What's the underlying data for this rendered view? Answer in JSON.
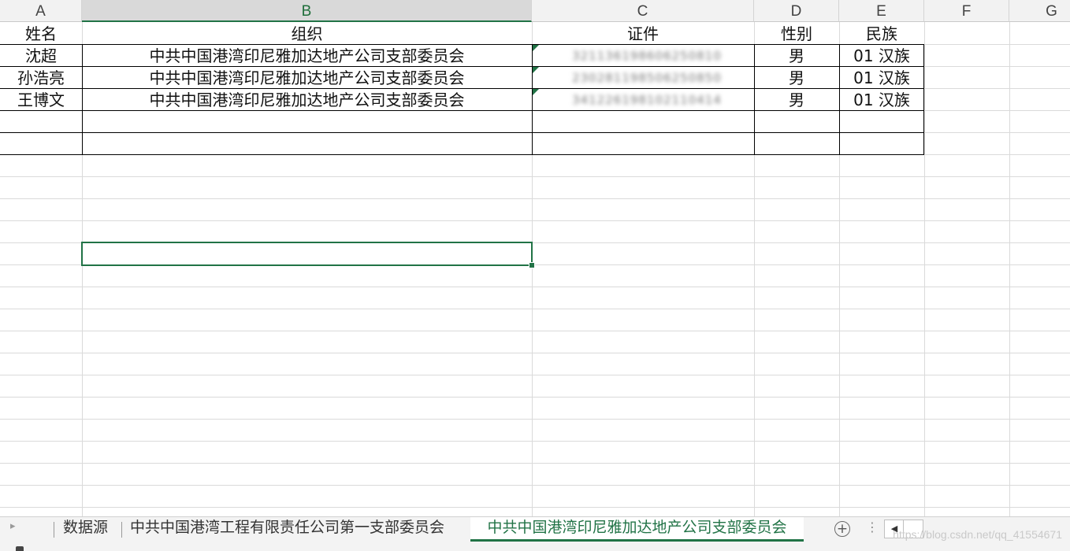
{
  "columns": [
    "A",
    "B",
    "C",
    "D",
    "E",
    "F",
    "G"
  ],
  "header_row": {
    "name": "姓名",
    "org": "组织",
    "id": "证件",
    "gender": "性别",
    "ethnicity": "民族"
  },
  "rows": [
    {
      "name": "沈超",
      "org": "中共中国港湾印尼雅加达地产公司支部委员会",
      "id": "321136198606250810",
      "gender": "男",
      "ethnicity": "01 汉族"
    },
    {
      "name": "孙浩亮",
      "org": "中共中国港湾印尼雅加达地产公司支部委员会",
      "id": "230281198506250850",
      "gender": "男",
      "ethnicity": "01 汉族"
    },
    {
      "name": "王博文",
      "org": "中共中国港湾印尼雅加达地产公司支部委员会",
      "id": "341226198102110414",
      "gender": "男",
      "ethnicity": "01 汉族"
    }
  ],
  "tabs": {
    "tab1": "数据源",
    "tab2": "中共中国港湾工程有限责任公司第一支部委员会",
    "tab3": "中共中国港湾印尼雅加达地产公司支部委员会"
  },
  "watermark": "https://blog.csdn.net/qq_41554671",
  "colors": {
    "accent": "#217346"
  }
}
